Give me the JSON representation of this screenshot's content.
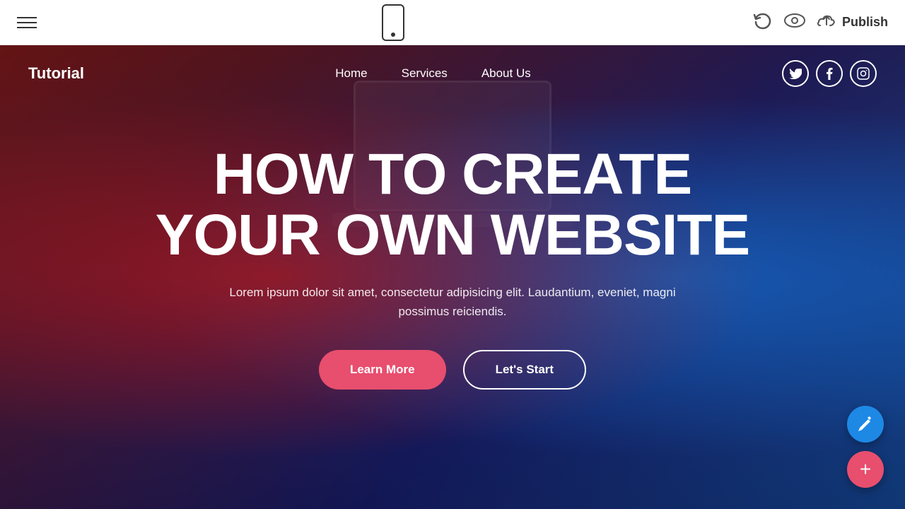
{
  "toolbar": {
    "publish_label": "Publish",
    "hamburger_aria": "Menu",
    "phone_aria": "Mobile preview",
    "undo_aria": "Undo",
    "eye_aria": "Preview",
    "cloud_aria": "Upload/Publish"
  },
  "website": {
    "logo": "Tutorial",
    "nav": {
      "links": [
        {
          "label": "Home",
          "href": "#"
        },
        {
          "label": "Services",
          "href": "#"
        },
        {
          "label": "About Us",
          "href": "#"
        }
      ]
    },
    "social": [
      {
        "name": "twitter",
        "symbol": "𝕋"
      },
      {
        "name": "facebook",
        "symbol": "f"
      },
      {
        "name": "instagram",
        "symbol": "📷"
      }
    ],
    "hero": {
      "title_line1": "HOW TO CREATE",
      "title_line2": "YOUR OWN WEBSITE",
      "subtitle": "Lorem ipsum dolor sit amet, consectetur adipisicing elit. Laudantium, eveniet, magni possimus reiciendis.",
      "btn_learn_more": "Learn More",
      "btn_lets_start": "Let's Start"
    }
  },
  "fab": {
    "edit_label": "✏",
    "add_label": "+"
  }
}
